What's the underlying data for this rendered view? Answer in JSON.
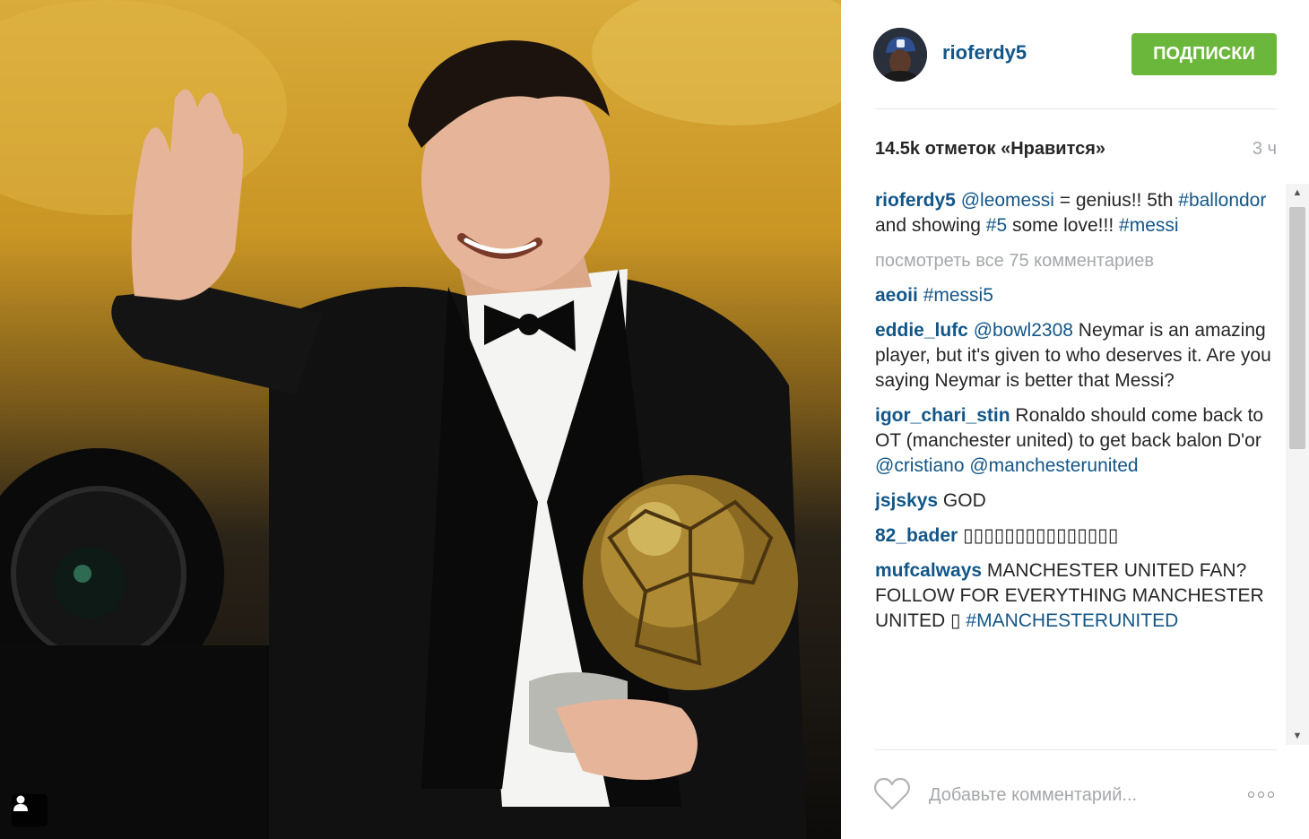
{
  "post": {
    "username": "rioferdy5",
    "follow_label": "ПОДПИСКИ",
    "likes": "14.5k отметок «Нравится»",
    "time": "3 ч",
    "caption": {
      "user": "rioferdy5",
      "parts": [
        {
          "type": "link",
          "text": "@leomessi"
        },
        {
          "type": "text",
          "text": " = genius!! 5th "
        },
        {
          "type": "link",
          "text": "#ballondor"
        },
        {
          "type": "text",
          "text": " and showing "
        },
        {
          "type": "link",
          "text": "#5"
        },
        {
          "type": "text",
          "text": " some love!!! "
        },
        {
          "type": "link",
          "text": "#messi"
        }
      ]
    },
    "view_all": "посмотреть все 75 комментариев",
    "add_comment_placeholder": "Добавьте комментарий..."
  },
  "comments": [
    {
      "user": "aeoii",
      "parts": [
        {
          "type": "link",
          "text": "#messi5"
        }
      ]
    },
    {
      "user": "eddie_lufc",
      "parts": [
        {
          "type": "link",
          "text": "@bowl2308"
        },
        {
          "type": "text",
          "text": " Neymar is an amazing player, but it's given to who deserves it. Are you saying Neymar is better that Messi?"
        }
      ]
    },
    {
      "user": "igor_chari_stin",
      "parts": [
        {
          "type": "text",
          "text": "Ronaldo should come back to OT (manchester united) to get back balon D'or "
        },
        {
          "type": "link",
          "text": "@cristiano"
        },
        {
          "type": "text",
          "text": " "
        },
        {
          "type": "link",
          "text": "@manchesterunited"
        }
      ]
    },
    {
      "user": "jsjskys",
      "parts": [
        {
          "type": "text",
          "text": "GOD"
        }
      ]
    },
    {
      "user": "82_bader",
      "parts": [
        {
          "type": "text",
          "text": "▯▯▯▯▯▯▯▯▯▯▯▯▯▯▯"
        }
      ]
    },
    {
      "user": "mufcalways",
      "parts": [
        {
          "type": "text",
          "text": "MANCHESTER UNITED FAN? FOLLOW FOR EVERYTHING MANCHESTER UNITED ▯ "
        },
        {
          "type": "link",
          "text": "#MANCHESTERUNITED"
        }
      ]
    }
  ],
  "colors": {
    "link": "#125688",
    "follow_button": "#6bb73b",
    "muted_text": "#a5a7aa"
  },
  "icons": {
    "tag": "person-icon",
    "like": "heart-outline-icon",
    "more": "more-dots-icon"
  }
}
